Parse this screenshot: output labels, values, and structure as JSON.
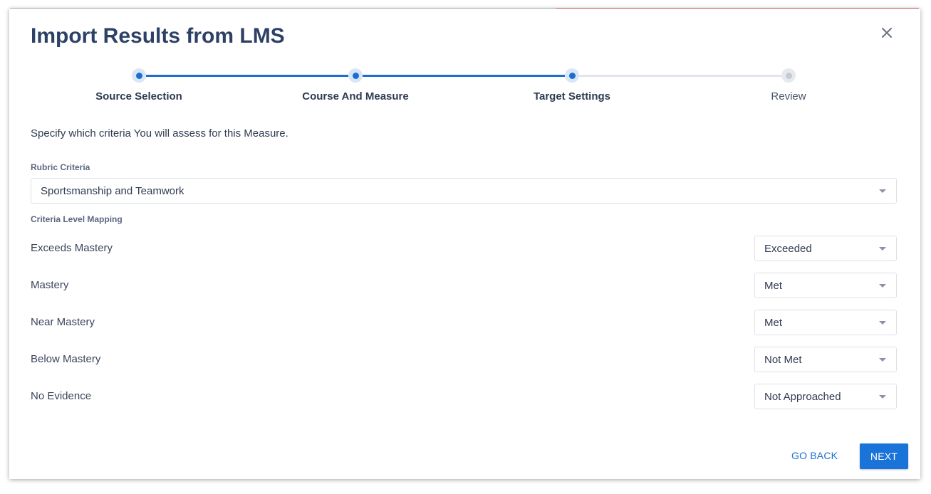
{
  "dialog": {
    "title": "Import Results from LMS",
    "close_icon": "close-icon"
  },
  "stepper": {
    "steps": [
      {
        "label": "Source Selection",
        "state": "completed"
      },
      {
        "label": "Course And Measure",
        "state": "completed"
      },
      {
        "label": "Target Settings",
        "state": "current"
      },
      {
        "label": "Review",
        "state": "pending"
      }
    ]
  },
  "instructions": "Specify which criteria You will assess for this Measure.",
  "rubric": {
    "label": "Rubric Criteria",
    "selected": "Sportsmanship and Teamwork"
  },
  "mapping": {
    "label": "Criteria Level Mapping",
    "rows": [
      {
        "level": "Exceeds Mastery",
        "value": "Exceeded"
      },
      {
        "level": "Mastery",
        "value": "Met"
      },
      {
        "level": "Near Mastery",
        "value": "Met"
      },
      {
        "level": "Below Mastery",
        "value": "Not Met"
      },
      {
        "level": "No Evidence",
        "value": "Not Approached"
      }
    ]
  },
  "footer": {
    "back_label": "GO BACK",
    "next_label": "NEXT"
  },
  "colors": {
    "accent": "#1a6fd1",
    "title": "#2d4166",
    "next_button": "#1a73d9"
  }
}
